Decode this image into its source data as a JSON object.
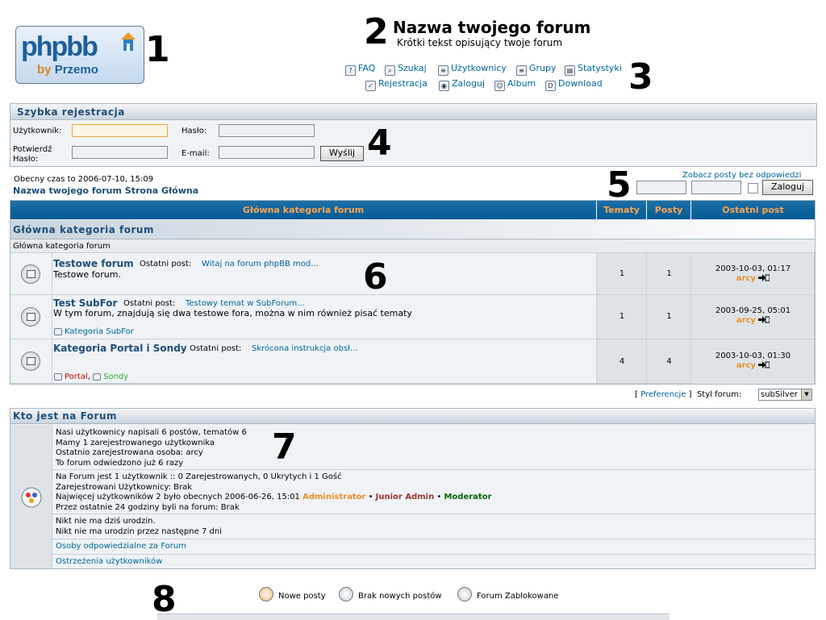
{
  "callouts": [
    "1",
    "2",
    "3",
    "4",
    "5",
    "6",
    "7",
    "8"
  ],
  "header": {
    "logo": {
      "php": "phpbb",
      "by": "by",
      "author": "Przemo"
    },
    "site_name": "Nazwa twojego forum",
    "site_desc": "Krótki tekst opisujący twoje forum"
  },
  "nav": {
    "row1": [
      {
        "label": "FAQ",
        "icon": "faq-icon"
      },
      {
        "label": "Szukaj",
        "icon": "search-icon"
      },
      {
        "label": "Użytkownicy",
        "icon": "users-icon"
      },
      {
        "label": "Grupy",
        "icon": "groups-icon"
      },
      {
        "label": "Statystyki",
        "icon": "stats-icon"
      }
    ],
    "row2": [
      {
        "label": "Rejestracja",
        "icon": "register-icon"
      },
      {
        "label": "Zaloguj",
        "icon": "login-icon"
      },
      {
        "label": "Album",
        "icon": "album-icon"
      },
      {
        "label": "Download",
        "icon": "download-icon"
      }
    ]
  },
  "quick_register": {
    "title": "Szybka rejestracja",
    "username_label": "Użytkownik:",
    "password_label": "Hasło:",
    "confirm_label_1": "Potwierdź",
    "confirm_label_2": "Hasło:",
    "email_label": "E-mail:",
    "submit": "Wyślij"
  },
  "info": {
    "current_time": "Obecny czas to 2006-07-10, 15:09",
    "breadcrumb": "Nazwa twojego forum Strona Główna",
    "unanswered_link": "Zobacz posty bez odpowiedzi",
    "login_button": "Zaloguj"
  },
  "table": {
    "headers": {
      "forum": "Główna kategoria forum",
      "topics": "Tematy",
      "posts": "Posty",
      "last": "Ostatni post"
    },
    "category_title": "Główna kategoria forum",
    "category_sub": "Główna kategoria forum",
    "last_post_label": "Ostatni post:",
    "forums": [
      {
        "name": "Testowe forum",
        "last_post_link": "Witaj na forum phpBB mod...",
        "desc": "Testowe forum.",
        "subforums": [],
        "topics": "1",
        "posts": "1",
        "date": "2003-10-03, 01:17",
        "user": "arcy"
      },
      {
        "name": "Test SubFor",
        "last_post_link": "Testowy temat w SubForum...",
        "desc": "W tym forum, znajdują się dwa testowe fora, można w nim również pisać tematy",
        "subforums": [
          {
            "label": "Kategoria SubFor",
            "color": "#006699"
          }
        ],
        "topics": "1",
        "posts": "1",
        "date": "2003-09-25, 05:01",
        "user": "arcy"
      },
      {
        "name": "Kategoria Portal i Sondy",
        "last_post_link": "Skrócona instrukcja obsł...",
        "desc": "",
        "subforums": [
          {
            "label": "Portal",
            "color": "#cc0000",
            "sep": ","
          },
          {
            "label": "Sondy",
            "color": "#33aa33"
          }
        ],
        "topics": "4",
        "posts": "4",
        "date": "2003-10-03, 01:30",
        "user": "arcy"
      }
    ]
  },
  "prefs": {
    "open": "[",
    "link": "Preferencje",
    "close": "]",
    "style_label": "Styl forum:",
    "style_value": "subSilver"
  },
  "who": {
    "title": "Kto jest na Forum",
    "stats": [
      "Nasi użytkownicy napisali 6 postów, tematów 6",
      "Mamy 1 zarejestrowanego użytkownika",
      "Ostatnio zarejestrowana osoba: arcy",
      "To forum odwiedzono już 6 razy"
    ],
    "online": [
      "Na Forum jest 1 użytkownik :: 0 Zarejestrowanych, 0 Ukrytych i 1 Gość",
      "Zarejestrowani Użytkownicy: Brak",
      "Najwięcej użytkowników 2 było obecnych 2006-06-26, 15:01"
    ],
    "groups": [
      {
        "label": "Administrator",
        "color": "#e9902a"
      },
      {
        "label": "Junior Admin",
        "color": "#993333"
      },
      {
        "label": "Moderator",
        "color": "#006600"
      }
    ],
    "last24": "Przez ostatnie 24 godziny byli na forum: Brak",
    "birthdays": [
      "Nikt nie ma dziś urodzin.",
      "Nikt nie ma urodzin przez następne 7 dni"
    ],
    "staff_link": "Osoby odpowiedzialne za Forum",
    "warnings_link": "Ostrzeżenia użytkowników"
  },
  "legend": [
    {
      "label": "Nowe posty",
      "icon": "new-posts-icon",
      "color": "#e9902a"
    },
    {
      "label": "Brak nowych postów",
      "icon": "no-new-posts-icon",
      "color": "#888888"
    },
    {
      "label": "Forum Zablokowane",
      "icon": "locked-forum-icon",
      "color": "#888888"
    }
  ]
}
